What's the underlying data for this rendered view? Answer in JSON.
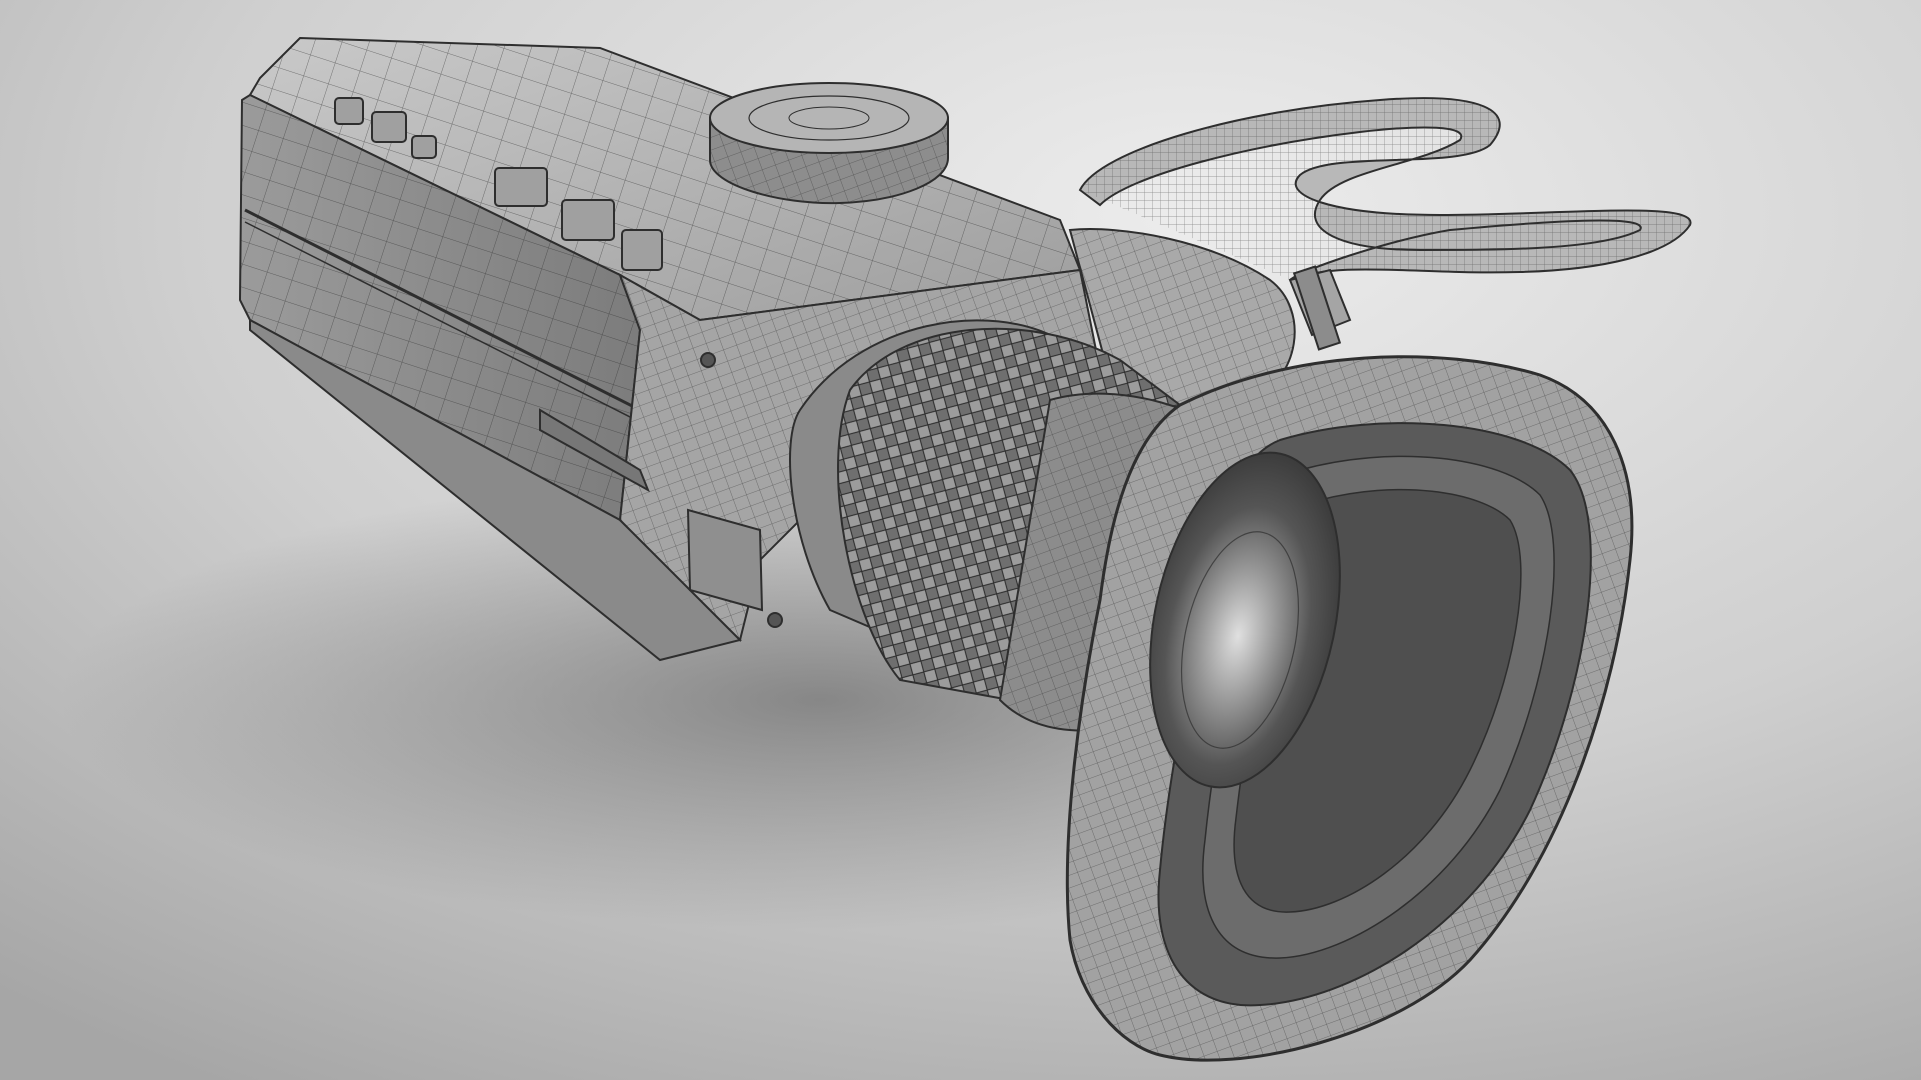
{
  "scene": {
    "subject": "camera-wireframe-render",
    "palette": {
      "background_light": "#e9e9e9",
      "background_dark": "#a9a9a9",
      "shadow": "#8f8f8f",
      "body": "#9a9a9a",
      "body_light": "#c2c2c2",
      "body_dark": "#7a7a7a",
      "wire": "#2e2e2e",
      "lens_inner": "#4a4a4a",
      "glass": "#d6d6d6"
    }
  }
}
